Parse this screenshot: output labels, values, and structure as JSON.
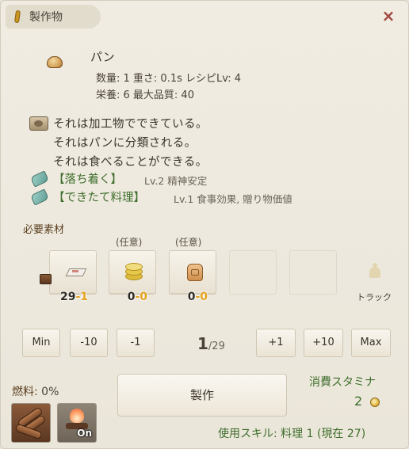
{
  "window": {
    "title": "製作物",
    "close_label": "×"
  },
  "item": {
    "name": "パン",
    "stats_line1": "数量: 1  重さ: 0.1s  レシピLv: 4",
    "stats_line2": "栄養: 6  最大品質: 40",
    "icon": "bread-icon"
  },
  "description": {
    "lines": [
      "それは加工物でできている。",
      "それはパンに分類される。",
      "それは食べることができる。"
    ]
  },
  "traits": [
    {
      "name": "【落ち着く】",
      "detail": "Lv.2 精神安定"
    },
    {
      "name": "【できたて料理】",
      "detail": "Lv.1 食事効果, 贈り物価値"
    }
  ],
  "materials": {
    "section_label": "必要素材",
    "optional_label": "(任意)",
    "slots": [
      {
        "have": "29",
        "need": "-1",
        "optional": false,
        "icon": "flour-icon"
      },
      {
        "have": "0",
        "need": "-0",
        "optional": true,
        "icon": "coins-icon"
      },
      {
        "have": "0",
        "need": "-0",
        "optional": true,
        "icon": "bag-icon"
      }
    ],
    "truck_label": "トラック"
  },
  "quantity": {
    "buttons": [
      "Min",
      "-10",
      "-1",
      "+1",
      "+10",
      "Max"
    ],
    "current": "1",
    "max": "/29"
  },
  "fuel": {
    "label": "燃料:",
    "value": "0%",
    "toggle_label": "On"
  },
  "craft": {
    "button_label": "製作"
  },
  "stamina": {
    "label": "消費スタミナ",
    "value": "2"
  },
  "skill": {
    "text": "使用スキル: 料理 1 (現在 27)"
  },
  "colors": {
    "accent_green": "#3e6e2c",
    "required_orange": "#e2a11e",
    "close_red": "#a2473f"
  }
}
